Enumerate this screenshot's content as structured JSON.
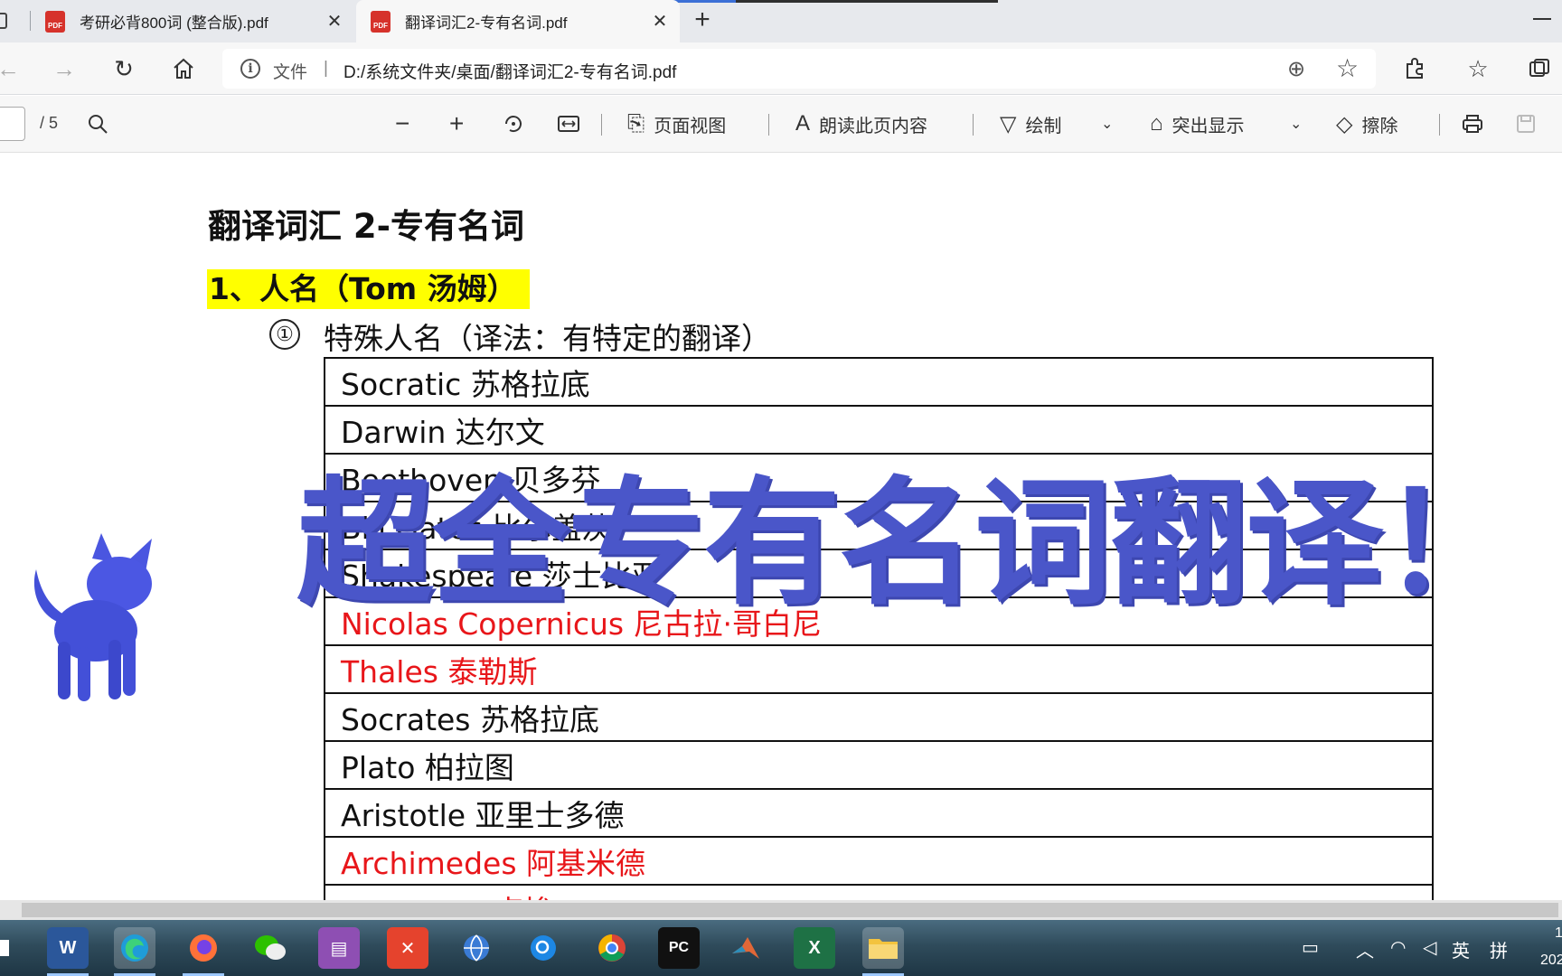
{
  "browser": {
    "tabs": [
      {
        "title": "考研必背800词 (整合版).pdf",
        "icon": "pdf-icon",
        "active": false
      },
      {
        "title": "翻译词汇2-专有名词.pdf",
        "icon": "pdf-icon",
        "active": true
      }
    ],
    "new_tab_label": "+",
    "address": {
      "scheme_label": "文件",
      "separator": "|",
      "url": "D:/系统文件夹/桌面/翻译词汇2-专有名词.pdf"
    }
  },
  "pdf_toolbar": {
    "page_input": "",
    "page_count": "/ 5",
    "page_view_label": "页面视图",
    "read_aloud_label": "朗读此页内容",
    "draw_label": "绘制",
    "highlight_label": "突出显示",
    "erase_label": "擦除"
  },
  "document": {
    "title": "翻译词汇 2-专有名词",
    "section1": "1、人名（Tom 汤姆）",
    "subsection1_number": "①",
    "subsection1_title": "特殊人名（译法：有特定的翻译）",
    "names": [
      {
        "text": "Socratic  苏格拉底",
        "color": "#111111"
      },
      {
        "text": "Darwin  达尔文",
        "color": "#111111"
      },
      {
        "text": "Beethoven  贝多芬",
        "color": "#111111"
      },
      {
        "text": "Bill Gates  比尔盖茨",
        "color": "#111111"
      },
      {
        "text": "Shakespeare  莎士比亚",
        "color": "#111111"
      },
      {
        "text": "Nicolas Copernicus 尼古拉·哥白尼",
        "color": "#e8161a"
      },
      {
        "text": "Thales  泰勒斯",
        "color": "#e8161a"
      },
      {
        "text": "Socrates  苏格拉底",
        "color": "#111111"
      },
      {
        "text": "Plato  柏拉图",
        "color": "#111111"
      },
      {
        "text": "Aristotle  亚里士多德",
        "color": "#111111"
      },
      {
        "text": "Archimedes  阿基米德",
        "color": "#e8161a"
      },
      {
        "text": "Rousseau  卢梭",
        "color": "#e8161a"
      }
    ]
  },
  "overlay": {
    "caption": "超全专有名词翻译！",
    "color": "#4a56c9"
  },
  "taskbar": {
    "apps": [
      "word-icon",
      "edge-icon",
      "firefox-icon",
      "wechat-icon",
      "winrar-icon",
      "xmind-icon",
      "network-globe-icon",
      "search-app-icon",
      "chrome-icon",
      "pycharm-icon",
      "matlab-icon",
      "excel-icon",
      "file-explorer-icon"
    ],
    "word_label": "W",
    "excel_label": "X",
    "pycharm_label": "PC",
    "ime_lang": "英",
    "ime_mode": "拼",
    "clock_time": "1",
    "clock_date": "202"
  }
}
